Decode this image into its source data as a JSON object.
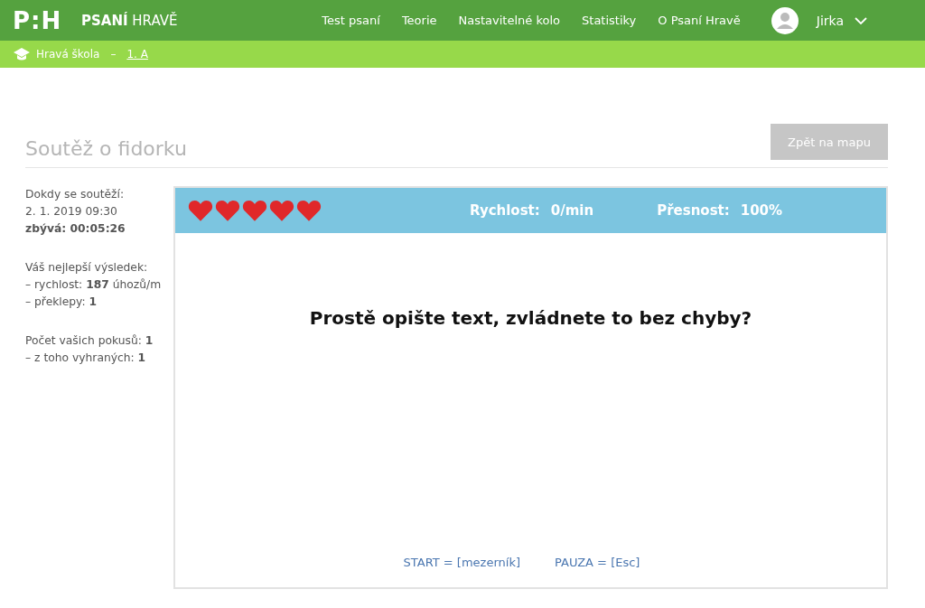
{
  "header": {
    "logo": "P:H",
    "brand_bold": "PSANÍ",
    "brand_light": "HRAVĚ",
    "nav": [
      "Test psaní",
      "Teorie",
      "Nastavitelné kolo",
      "Statistiky",
      "O Psaní Hravě"
    ],
    "user": "Jirka"
  },
  "breadcrumb": {
    "school": "Hravá škola",
    "separator": "–",
    "class": "1. A"
  },
  "page_title": "Soutěž o fidorku",
  "back_button": "Zpět na mapu",
  "sidebar": [
    [
      "Dokdy se soutěží:",
      "2. 1. 2019 09:30",
      "**zbývá: 00:05:26**"
    ],
    [
      "Váš nejlepší výsledek:",
      "– rychlost: **187** úhozů/m",
      "– překlepy: **1**"
    ],
    [
      "Počet vašich pokusů: **1**",
      "– z toho vyhraných: **1**"
    ]
  ],
  "game": {
    "hearts": [
      {
        "full": true
      },
      {
        "full": true
      },
      {
        "full": true
      },
      {
        "full": true
      },
      {
        "full": true
      }
    ],
    "stats": [
      {
        "label": "Rychlost:",
        "value": "0/min"
      },
      {
        "label": "Přesnost:",
        "value": "100%"
      }
    ],
    "prompt": "Prostě opište text, zvládnete to bez chyby?",
    "hints": [
      "START = [mezerník]",
      "PAUZA = [Esc]"
    ]
  }
}
